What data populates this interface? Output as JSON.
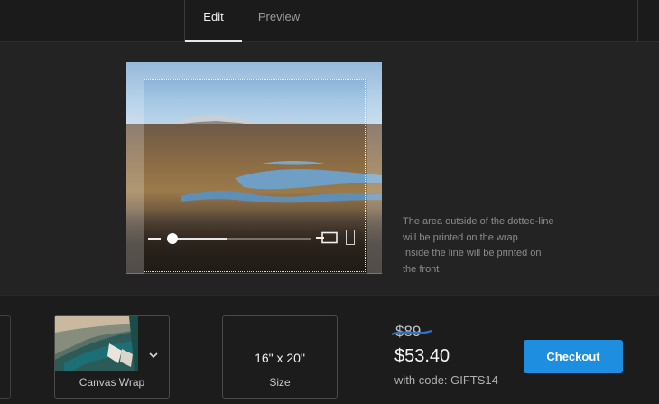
{
  "tabs": [
    {
      "label": "Edit",
      "active": true
    },
    {
      "label": "Preview",
      "active": false
    }
  ],
  "editor": {
    "hint_lines": [
      "The area outside of the dotted-line",
      "will be printed on the wrap",
      "Inside the line will be printed on",
      "the front"
    ],
    "zoom_level": 0.28
  },
  "options": {
    "wrap": {
      "label": "Canvas Wrap",
      "icon": "chevron-down-icon"
    },
    "size": {
      "value": "16\" x 20\"",
      "label": "Size"
    }
  },
  "pricing": {
    "original": "$89",
    "discounted": "$53.40",
    "promo": "with code: GIFTS14"
  },
  "checkout": {
    "label": "Checkout",
    "color": "#1d8ee0"
  }
}
